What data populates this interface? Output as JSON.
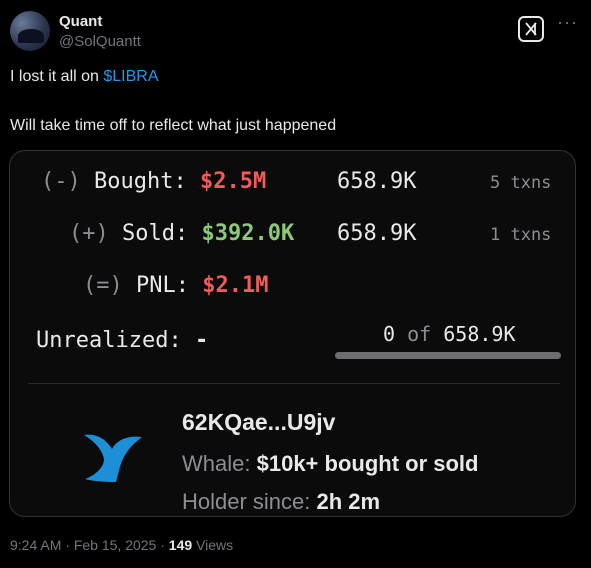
{
  "author": {
    "name": "Quant",
    "handle": "@SolQuantt"
  },
  "post": {
    "line1_prefix": "I lost it all on ",
    "cashtag": "$LIBRA",
    "line2": "Will take time off to reflect what just happened"
  },
  "card": {
    "bought": {
      "prefix": "(-)",
      "label": "Bought:",
      "value": "$2.5M",
      "amount": "658.9K",
      "txns": "5 txns"
    },
    "sold": {
      "prefix": "(+)",
      "label": "Sold:",
      "value": "$392.0K",
      "amount": "658.9K",
      "txns": "1 txns"
    },
    "pnl": {
      "prefix": "(=)",
      "label": "PNL:",
      "value": "$2.1M"
    },
    "unrealized": {
      "label": "Unrealized:",
      "value": "-",
      "held": "0",
      "of": "of",
      "total": "658.9K",
      "held_fraction": 0
    },
    "wallet": {
      "address": "62KQae...U9jv",
      "whale_label": "Whale:",
      "whale_value": "$10k+ bought or sold",
      "holder_label": "Holder since:",
      "holder_value": "2h 2m"
    },
    "colors": {
      "loss": "#f05c5c",
      "gain": "#8cc97a",
      "whale": "#1d8fd6"
    }
  },
  "meta": {
    "time": "9:24 AM",
    "separator": "·",
    "date": "Feb 15, 2025",
    "views_count": "149",
    "views_label": "Views"
  },
  "icons": {
    "grok": "grok-icon",
    "more": "more-icon",
    "whale": "whale-tail-icon"
  },
  "more_glyph": "···"
}
